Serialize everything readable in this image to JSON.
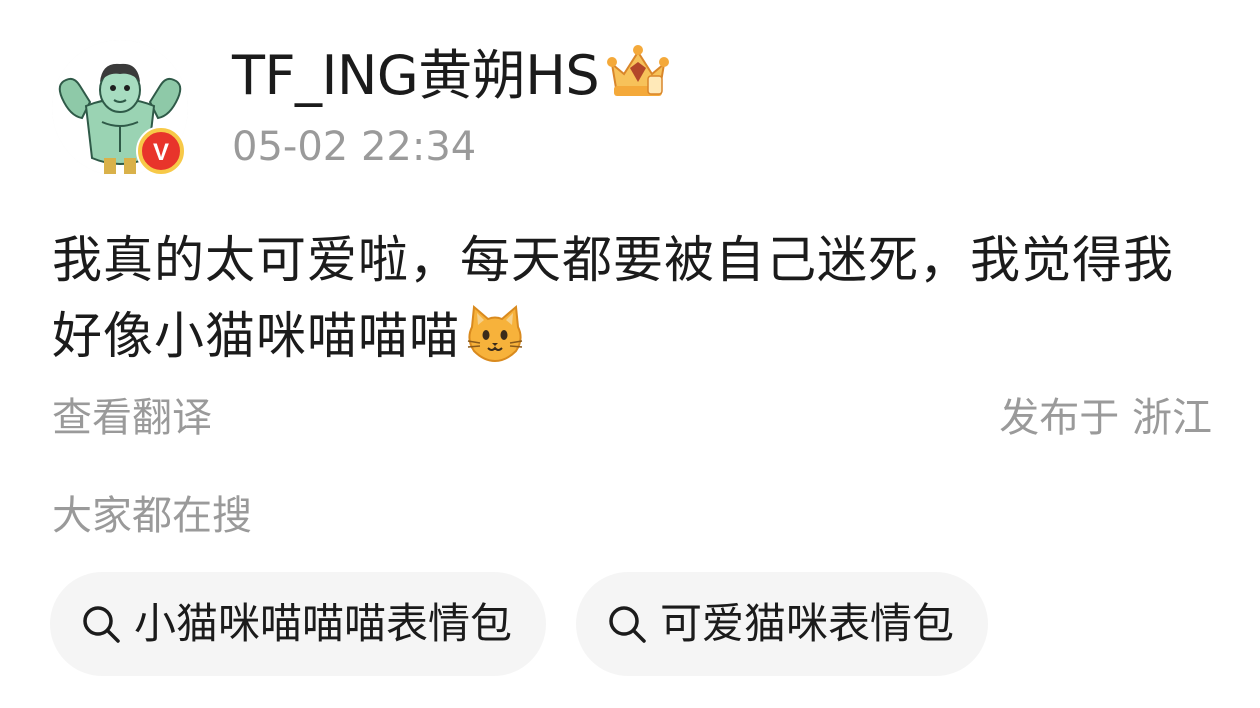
{
  "post": {
    "author": {
      "name": "TF_ING黄朔HS",
      "verified_badge_letter": "V",
      "avatar_icon": "muscle-cartoon-avatar",
      "badge_icon": "gold-crown-badge-icon"
    },
    "timestamp": "05-02 22:34",
    "text": "我真的太可爱啦，每天都要被自己迷死，我觉得我好像小猫咪喵喵喵",
    "emoji_icon": "cat-face-emoji",
    "translate_label": "查看翻译",
    "location_label": "发布于 浙江"
  },
  "searches": {
    "title": "大家都在搜",
    "items": [
      {
        "label": "小猫咪喵喵喵表情包",
        "icon": "search-icon"
      },
      {
        "label": "可爱猫咪表情包",
        "icon": "search-icon"
      }
    ]
  },
  "colors": {
    "primary_text": "#1b1b1b",
    "secondary_text": "#9a9a9a",
    "chip_bg": "#f5f5f5",
    "verified_red": "#e8342b",
    "verified_ring": "#f7c948",
    "crown_gold": "#f4a93a"
  }
}
